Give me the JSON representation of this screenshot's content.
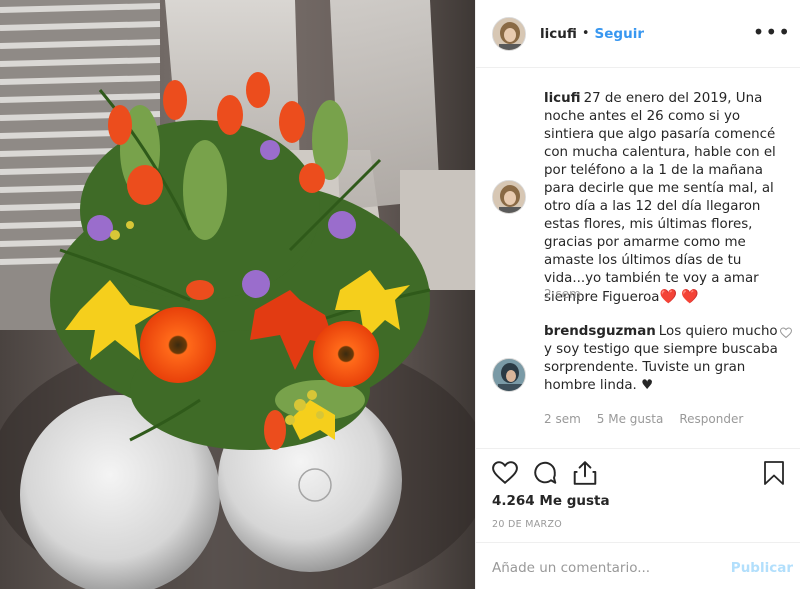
{
  "post": {
    "username": "licufi",
    "separator": "•",
    "follow_label": "Seguir",
    "more_label": "•••"
  },
  "caption": {
    "username": "licufi",
    "text": "27 de enero del 2019, Una noche antes el 26 como si yo sintiera que algo pasaría comencé con mucha calentura, hable con el por teléfono a la 1 de la mañana para decirle que me sentía mal, al otro día a las 12 del día llegaron estas flores, mis últimas flores, gracias por amarme como me amaste los últimos días de tu vida...yo también te voy a amar siempre Figueroa",
    "emoji": "❤️ ❤️",
    "time": "2 sem"
  },
  "comment": {
    "username": "brendsguzman",
    "text": "Los quiero mucho y soy testigo que siempre buscaba sorprendente. Tuviste un gran hombre linda.",
    "emoji": "♥",
    "time": "2 sem",
    "likes": "5 Me gusta",
    "reply_label": "Responder"
  },
  "actions": {
    "like_icon": "heart-outline-icon",
    "comment_icon": "speech-bubble-icon",
    "share_icon": "share-icon",
    "save_icon": "bookmark-icon"
  },
  "likes_text": "4.264 Me gusta",
  "date_text": "20 DE MARZO",
  "add_comment": {
    "placeholder": "Añade un comentario...",
    "publish_label": "Publicar"
  },
  "colors": {
    "link_blue": "#3897f0",
    "publish_disabled": "#b2dffc",
    "muted_text": "#999999",
    "border": "#efefef"
  }
}
